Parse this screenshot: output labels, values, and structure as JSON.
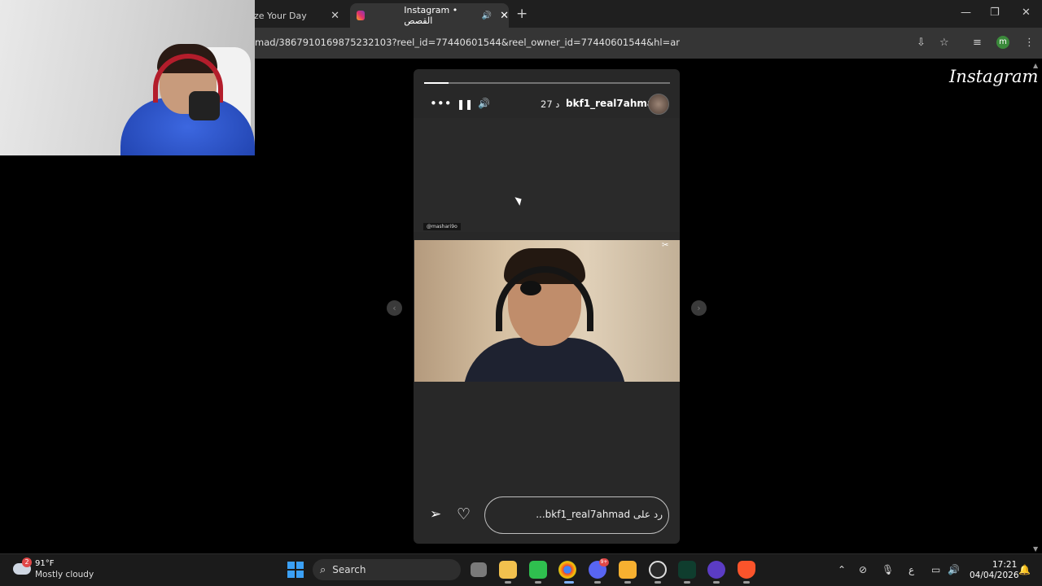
{
  "browser": {
    "tabs": [
      {
        "label": "ze Your Day"
      },
      {
        "label": "Instagram • القصص"
      }
    ],
    "new_tab": "+",
    "close_glyph": "✕",
    "url": "mad/3867910169875232103?reel_id=77440601544&reel_owner_id=77440601544&hl=ar",
    "profile_initial": "m"
  },
  "instagram": {
    "logo": "Instagram",
    "story": {
      "username": "bkf1_real7ahmad",
      "time_ago": "27 د",
      "progress": 0.1,
      "watermark": "@mashari9o",
      "reply_placeholder": "رد على bkf1_real7ahmad...",
      "controls": {
        "more": "•••",
        "pause": "❚❚",
        "mute": "🔊"
      }
    }
  },
  "taskbar": {
    "weather": {
      "badge": "2",
      "temp": "91°F",
      "desc": "Mostly cloudy"
    },
    "search_label": "Search",
    "discord_badge": "9+",
    "tray_lang": "ع",
    "clock": {
      "time": "17:21",
      "date": "04/04/2026"
    }
  },
  "colors": {
    "chrome_bg": "#1f1f1f",
    "toolbar_bg": "#353535",
    "story_bg": "#282828",
    "taskbar_bg": "#1b1b1b"
  }
}
